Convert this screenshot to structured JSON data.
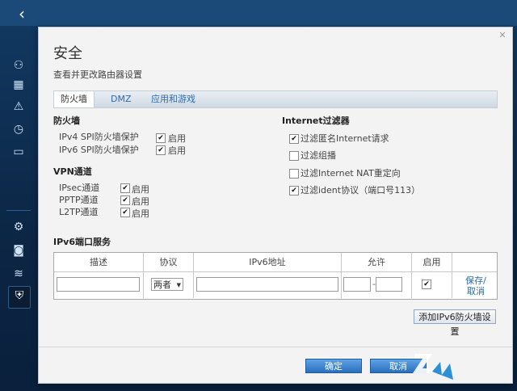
{
  "nav": {
    "back_icon": "chevron-left-icon",
    "side_icons": [
      "devices-icon",
      "calendar-icon",
      "warning-icon",
      "clock-icon",
      "storage-icon",
      "settings-icon",
      "camera-icon",
      "wifi-icon",
      "shield-icon"
    ]
  },
  "dialog": {
    "title": "安全",
    "subtitle": "查看并更改路由器设置",
    "close_label": "✕"
  },
  "tabs": [
    {
      "label": "防火墙",
      "active": true
    },
    {
      "label": "DMZ",
      "active": false
    },
    {
      "label": "应用和游戏",
      "active": false
    }
  ],
  "firewall": {
    "heading": "防火墙",
    "rows": [
      {
        "label": "IPv4 SPI防火墙保护",
        "option": "启用",
        "checked": true
      },
      {
        "label": "IPv6 SPI防火墙保护",
        "option": "启用",
        "checked": true
      }
    ]
  },
  "vpn": {
    "heading": "VPN通道",
    "rows": [
      {
        "label": "IPsec通道",
        "option": "启用",
        "checked": true
      },
      {
        "label": "PPTP通道",
        "option": "启用",
        "checked": true
      },
      {
        "label": "L2TP通道",
        "option": "启用",
        "checked": true
      }
    ]
  },
  "internet_filter": {
    "heading": "Internet过滤器",
    "rows": [
      {
        "label": "过滤匿名Internet请求",
        "checked": true
      },
      {
        "label": "过滤组播",
        "checked": false
      },
      {
        "label": "过滤Internet NAT重定向",
        "checked": false
      },
      {
        "label": "过滤ident协议（端口号113）",
        "checked": true
      }
    ]
  },
  "ipv6_ports": {
    "heading": "IPv6端口服务",
    "columns": [
      "描述",
      "协议",
      "IPv6地址",
      "允许",
      "启用"
    ],
    "protocol_value": "两者",
    "port_separator": "-",
    "enable_checked": true,
    "save_cancel_label": "保存/\n取消",
    "add_button": "添加IPv6防火墙设置"
  },
  "footer": {
    "ok_label": "确定",
    "cancel_label": "取消"
  },
  "colors": {
    "accent": "#2a6bb0",
    "app_bg": "#0d2a4a",
    "button_blue": "#2a6fbd"
  }
}
